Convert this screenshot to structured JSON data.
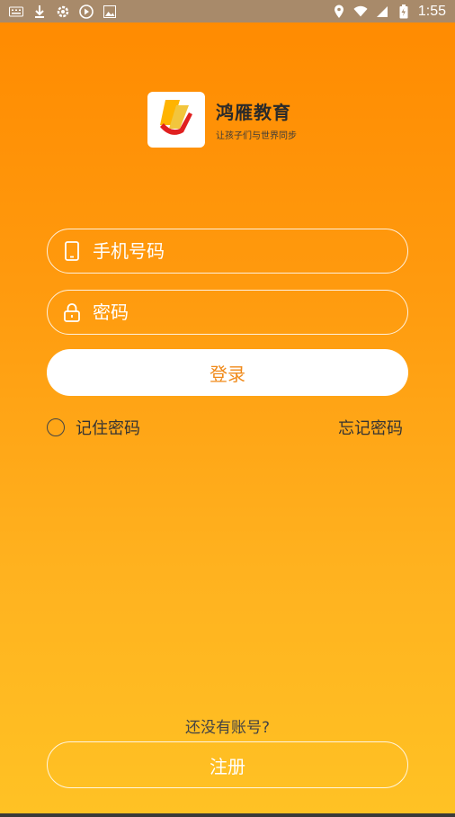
{
  "statusbar": {
    "left_icons": [
      "keyboard-icon",
      "download-icon",
      "gear-icon",
      "play-icon",
      "photo-icon"
    ],
    "right_icons": [
      "location-icon",
      "wifi-icon",
      "signal-icon",
      "battery-icon"
    ],
    "time": "1:55"
  },
  "brand": {
    "title": "鸿雁教育",
    "subtitle": "让孩子们与世界同步"
  },
  "form": {
    "phone_placeholder": "手机号码",
    "password_placeholder": "密码",
    "login_label": "登录",
    "remember_label": "记住密码",
    "forgot_label": "忘记密码"
  },
  "footer": {
    "no_account_text": "还没有账号?",
    "register_label": "注册"
  },
  "colors": {
    "gradient_top": "#ff8a00",
    "gradient_bottom": "#ffc224",
    "accent": "#f08a1a"
  }
}
